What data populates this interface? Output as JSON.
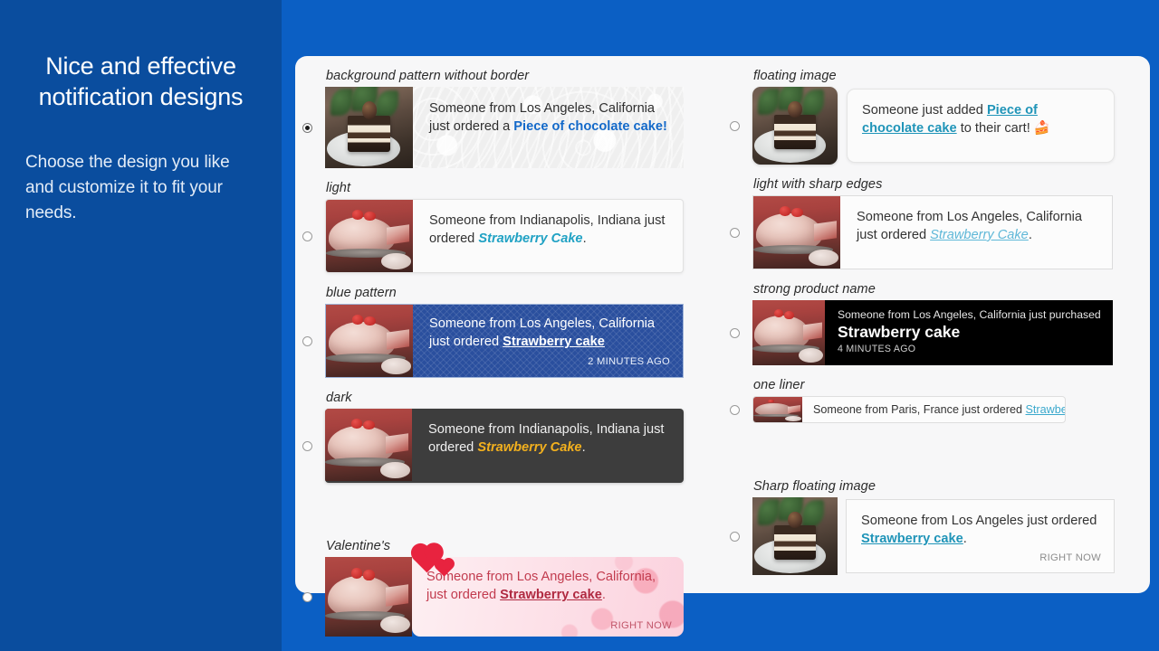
{
  "sidebar": {
    "heading": "Nice and effective notification designs",
    "subtext": "Choose the design you like and customize it to fit your needs."
  },
  "designs": {
    "background_pattern": {
      "label": "background pattern without border",
      "selected": true,
      "text_before": "Someone from Los Angeles, California just ordered a ",
      "product": "Piece of chocolate cake!",
      "text_after": ""
    },
    "light": {
      "label": "light",
      "selected": false,
      "text_before": "Someone from Indianapolis, Indiana just ordered ",
      "product": "Strawberry Cake",
      "text_after": "."
    },
    "blue_pattern": {
      "label": "blue pattern",
      "selected": false,
      "text_before": "Someone from Los Angeles, California just ordered ",
      "product": "Strawberry cake",
      "text_after": "",
      "timestamp": "2 MINUTES AGO"
    },
    "dark": {
      "label": "dark",
      "selected": false,
      "text_before": "Someone from Indianapolis, Indiana just ordered ",
      "product": "Strawberry Cake",
      "text_after": "."
    },
    "valentines": {
      "label": "Valentine's",
      "selected": false,
      "text_before": "Someone from Los Angeles, California, just ordered ",
      "product": "Strawberry cake",
      "text_after": ".",
      "timestamp": "RIGHT NOW"
    },
    "floating_image": {
      "label": "floating image",
      "selected": false,
      "text_before": "Someone just added ",
      "product": "Piece of chocolate cake",
      "text_after": " to their cart! 🍰"
    },
    "light_sharp_edges": {
      "label": "light with sharp edges",
      "selected": false,
      "text_before": "Someone from Los Angeles, California just ordered ",
      "product": "Strawberry Cake",
      "text_after": "."
    },
    "strong_product_name": {
      "label": "strong product name",
      "selected": false,
      "line1": "Someone from Los Angeles, California just purchased",
      "product": "Strawberry cake",
      "timestamp": "4 MINUTES AGO"
    },
    "one_liner": {
      "label": "one liner",
      "selected": false,
      "text_before": "Someone from Paris, France just ordered ",
      "product": "Strawberry Cake",
      "text_after": "."
    },
    "sharp_floating_image": {
      "label": "Sharp floating image",
      "selected": false,
      "text_before": "Someone from Los Angeles just ordered ",
      "product": "Strawberry cake",
      "text_after": ".",
      "timestamp": "RIGHT NOW"
    }
  },
  "colors": {
    "outer_background": "#0b5fc4",
    "sidebar_background": "#0a4d9e",
    "panel_background": "#f7f7f8",
    "link_blue": "#1369c9",
    "link_teal": "#21a2c4",
    "blue_pattern": "#2a4f9e",
    "dark_card": "#3d3d3d",
    "dark_accent": "#f2b01e",
    "valentine_pink": "#fde7ec",
    "valentine_red": "#c23b4e",
    "strong_card": "#000000"
  }
}
